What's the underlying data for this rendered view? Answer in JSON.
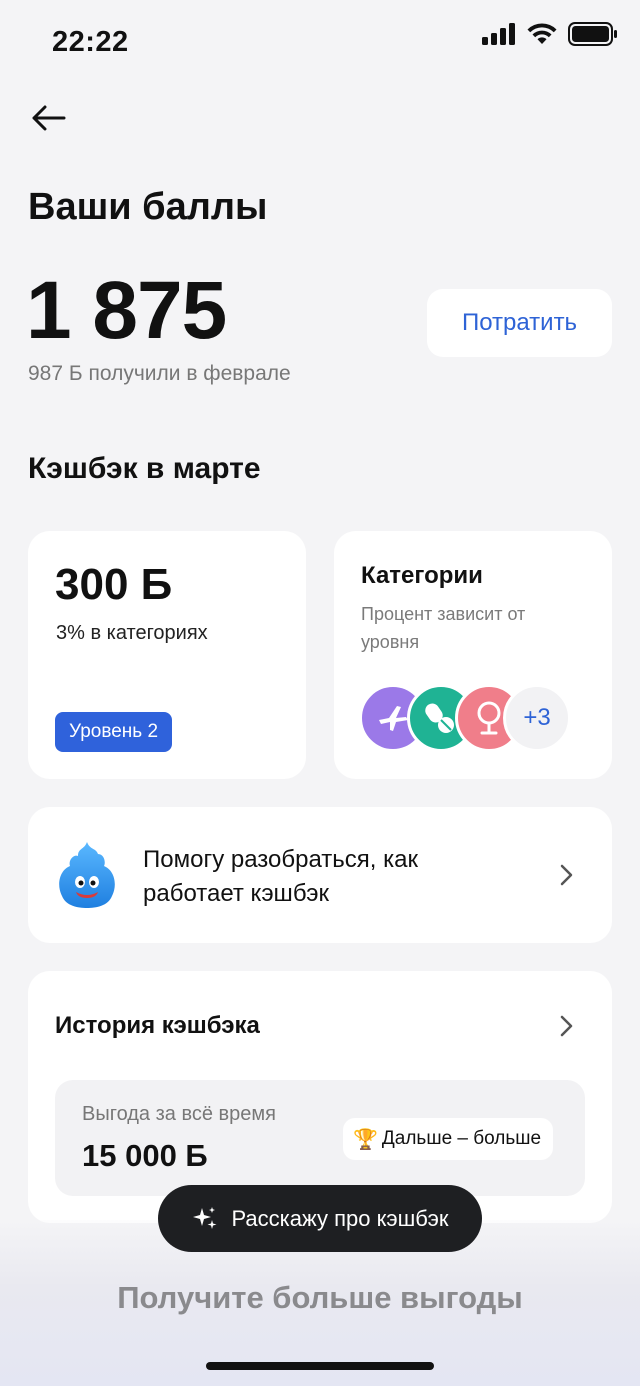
{
  "status_bar": {
    "time": "22:22"
  },
  "header": {
    "title": "Ваши баллы"
  },
  "points": {
    "value": "1 875",
    "subtitle": "987 Б получили в феврале",
    "spend_label": "Потратить"
  },
  "cashback": {
    "section_title": "Кэшбэк в марте",
    "value": "300 Б",
    "subtitle": "3% в категориях",
    "level_badge": "Уровень 2"
  },
  "categories": {
    "title": "Категории",
    "subtitle": "Процент зависит от уровня",
    "icons": [
      {
        "name": "plane-icon",
        "color": "#9b79e8"
      },
      {
        "name": "pills-icon",
        "color": "#1fb394"
      },
      {
        "name": "mirror-icon",
        "color": "#f07e8a"
      }
    ],
    "more_label": "+3"
  },
  "helper": {
    "text_line1": "Помогу разобраться, как",
    "text_line2": "работает кэшбэк"
  },
  "history": {
    "title": "История кэшбэка",
    "benefit_label": "Выгода за всё время",
    "benefit_value": "15 000 Б",
    "chip_emoji": "🏆",
    "chip_label": "Дальше – больше"
  },
  "ai_button": {
    "label": "Расскажу про кэшбэк"
  },
  "promo": {
    "title": "Получите больше выгоды"
  },
  "colors": {
    "accent": "#2e63d6",
    "badge": "#2f62db",
    "background": "#f4f4f6"
  }
}
